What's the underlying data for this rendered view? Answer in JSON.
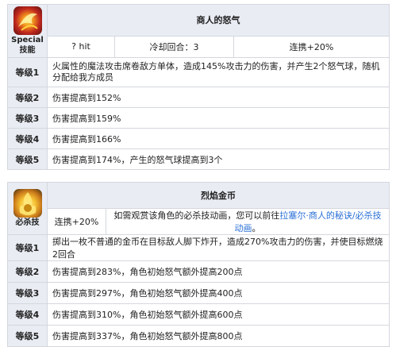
{
  "skill1": {
    "icon": "flame-swirl-icon",
    "type_en": "Special",
    "type_cn": "技能",
    "name": "商人的怒气",
    "hit": "? hit",
    "cooldown": "冷却回合：3",
    "combo": "连携+20%",
    "levels": [
      {
        "label": "等级1",
        "desc": "火属性的魔法攻击席卷敌方单体，造成145%攻击力的伤害，并产生2个怒气球，随机分配给我方成员"
      },
      {
        "label": "等级2",
        "desc": "伤害提高到152%"
      },
      {
        "label": "等级3",
        "desc": "伤害提高到159%"
      },
      {
        "label": "等级4",
        "desc": "伤害提高到166%"
      },
      {
        "label": "等级5",
        "desc": "伤害提高到174%，产生的怒气球提高到3个"
      }
    ]
  },
  "skill2": {
    "icon": "golden-flame-coin-icon",
    "type_cn": "必杀技",
    "name": "烈焰金币",
    "combo": "连携+20%",
    "note_prefix": "如需观赏该角色的必杀技动画，您可以前往",
    "note_link": "拉塞尔·商人的秘诀/必杀技动画",
    "note_suffix": "。",
    "levels": [
      {
        "label": "等级1",
        "desc": "掷出一枚不普通的金币在目标敌人脚下炸开，造成270%攻击力的伤害，并使目标燃烧2回合"
      },
      {
        "label": "等级2",
        "desc": "伤害提高到283%，角色初始怒气额外提高200点"
      },
      {
        "label": "等级3",
        "desc": "伤害提高到297%，角色初始怒气额外提高400点"
      },
      {
        "label": "等级4",
        "desc": "伤害提高到310%，角色初始怒气额外提高600点"
      },
      {
        "label": "等级5",
        "desc": "伤害提高到337%，角色初始怒气额外提高800点"
      }
    ]
  }
}
